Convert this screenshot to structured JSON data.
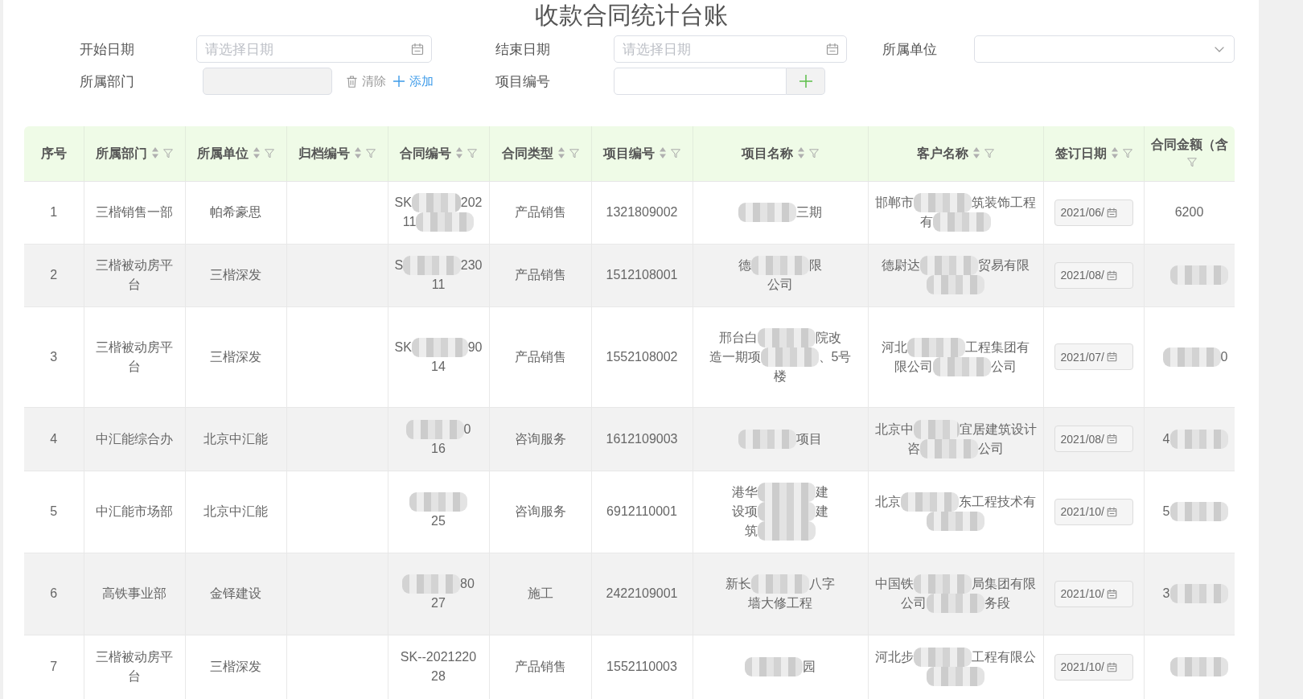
{
  "title": "收款合同统计台账",
  "filters": [
    {
      "kind": "date",
      "label": "开始日期",
      "placeholder": "请选择日期"
    },
    {
      "kind": "date",
      "label": "结束日期",
      "placeholder": "请选择日期"
    },
    {
      "kind": "select",
      "label": "所属单位"
    },
    {
      "kind": "picker",
      "label": "所属部门",
      "disabled": true,
      "actions": [
        {
          "kind": "clear",
          "label": "清除"
        },
        {
          "kind": "add",
          "label": "添加"
        }
      ]
    },
    {
      "kind": "input_add",
      "label": "项目编号"
    }
  ],
  "table": {
    "columns": [
      {
        "label": "序号",
        "sortable": false,
        "filterable": false
      },
      {
        "label": "所属部门",
        "sortable": true,
        "filterable": true
      },
      {
        "label": "所属单位",
        "sortable": true,
        "filterable": true
      },
      {
        "label": "归档编号",
        "sortable": true,
        "filterable": true
      },
      {
        "label": "合同编号",
        "sortable": true,
        "filterable": true
      },
      {
        "label": "合同类型",
        "sortable": true,
        "filterable": true
      },
      {
        "label": "项目编号",
        "sortable": true,
        "filterable": true
      },
      {
        "label": "项目名称",
        "sortable": true,
        "filterable": true
      },
      {
        "label": "客户名称",
        "sortable": true,
        "filterable": true
      },
      {
        "label": "签订日期",
        "sortable": true,
        "filterable": true
      },
      {
        "label": "合同金额（含",
        "sortable": false,
        "filterable": true
      }
    ],
    "rows": [
      {
        "index": "1",
        "department": "三楷销售一部",
        "unit": "帕希豪思",
        "contract_no": {
          "lines": [
            [
              {
                "kind": "text",
                "text": "SK"
              },
              {
                "kind": "mask"
              },
              {
                "kind": "text",
                "text": "202"
              }
            ],
            [
              {
                "kind": "text",
                "text": "11"
              },
              {
                "kind": "mask"
              }
            ]
          ]
        },
        "contract_type": "产品销售",
        "project_no": "1321809002",
        "project_name": {
          "lines": [
            [
              {
                "kind": "mask"
              },
              {
                "kind": "text",
                "text": "三期"
              }
            ]
          ]
        },
        "customer": {
          "lines": [
            [
              {
                "kind": "text",
                "text": "邯郸市"
              },
              {
                "kind": "mask"
              },
              {
                "kind": "text",
                "text": "筑装饰工程"
              }
            ],
            [
              {
                "kind": "text",
                "text": "有"
              },
              {
                "kind": "mask"
              }
            ]
          ]
        },
        "signed_date": "2021/06/",
        "amount": "6200"
      },
      {
        "index": "2",
        "department": "三楷被动房平台",
        "unit": "三楷深发",
        "contract_no": {
          "lines": [
            [
              {
                "kind": "text",
                "text": "S"
              },
              {
                "kind": "mask"
              },
              {
                "kind": "text",
                "text": "230"
              }
            ],
            [
              {
                "kind": "text",
                "text": "11"
              }
            ]
          ]
        },
        "contract_type": "产品销售",
        "project_no": "1512108001",
        "project_name": {
          "lines": [
            [
              {
                "kind": "text",
                "text": "德"
              },
              {
                "kind": "mask"
              },
              {
                "kind": "text",
                "text": "限"
              }
            ],
            [
              {
                "kind": "text",
                "text": "公司"
              }
            ]
          ]
        },
        "customer": {
          "lines": [
            [
              {
                "kind": "text",
                "text": "德尉达"
              },
              {
                "kind": "mask"
              },
              {
                "kind": "text",
                "text": "贸易有限"
              }
            ],
            [
              {
                "kind": "mask"
              }
            ]
          ]
        },
        "signed_date": "2021/08/",
        "amount": {
          "lines": [
            [
              {
                "kind": "mask"
              }
            ]
          ]
        }
      },
      {
        "index": "3",
        "department": "三楷被动房平台",
        "unit": "三楷深发",
        "contract_no": {
          "lines": [
            [
              {
                "kind": "text",
                "text": "SK"
              },
              {
                "kind": "mask"
              },
              {
                "kind": "text",
                "text": "90"
              }
            ],
            [
              {
                "kind": "text",
                "text": "14"
              }
            ]
          ]
        },
        "contract_type": "产品销售",
        "project_no": "1552108002",
        "project_name": {
          "lines": [
            [
              {
                "kind": "text",
                "text": "邢台白"
              },
              {
                "kind": "mask"
              },
              {
                "kind": "text",
                "text": "院改"
              }
            ],
            [
              {
                "kind": "text",
                "text": "造一期项"
              },
              {
                "kind": "mask"
              },
              {
                "kind": "text",
                "text": "、5号"
              }
            ],
            [
              {
                "kind": "text",
                "text": "楼"
              }
            ]
          ]
        },
        "customer": {
          "lines": [
            [
              {
                "kind": "text",
                "text": "河北"
              },
              {
                "kind": "mask"
              },
              {
                "kind": "text",
                "text": "工程集团有"
              }
            ],
            [
              {
                "kind": "text",
                "text": "限公司"
              },
              {
                "kind": "mask"
              },
              {
                "kind": "text",
                "text": "公司"
              }
            ]
          ]
        },
        "signed_date": "2021/07/",
        "amount": {
          "lines": [
            [
              {
                "kind": "mask"
              },
              {
                "kind": "text",
                "text": "0"
              }
            ]
          ]
        }
      },
      {
        "index": "4",
        "department": "中汇能综合办",
        "unit": "北京中汇能",
        "contract_no": {
          "lines": [
            [
              {
                "kind": "mask"
              },
              {
                "kind": "text",
                "text": "0"
              }
            ],
            [
              {
                "kind": "text",
                "text": "16"
              }
            ]
          ]
        },
        "contract_type": "咨询服务",
        "project_no": "1612109003",
        "project_name": {
          "lines": [
            [
              {
                "kind": "mask"
              },
              {
                "kind": "text",
                "text": "项目"
              }
            ]
          ]
        },
        "customer": {
          "lines": [
            [
              {
                "kind": "text",
                "text": "北京中"
              },
              {
                "kind": "mask"
              },
              {
                "kind": "text",
                "text": "宜居建筑设计"
              }
            ],
            [
              {
                "kind": "text",
                "text": "咨"
              },
              {
                "kind": "mask"
              },
              {
                "kind": "text",
                "text": "公司"
              }
            ]
          ]
        },
        "signed_date": "2021/08/",
        "amount": {
          "lines": [
            [
              {
                "kind": "text",
                "text": "4"
              },
              {
                "kind": "mask"
              }
            ]
          ]
        }
      },
      {
        "index": "5",
        "department": "中汇能市场部",
        "unit": "北京中汇能",
        "contract_no": {
          "lines": [
            [
              {
                "kind": "mask"
              }
            ],
            [
              {
                "kind": "text",
                "text": "25"
              }
            ]
          ]
        },
        "contract_type": "咨询服务",
        "project_no": "6912110001",
        "project_name": {
          "lines": [
            [
              {
                "kind": "text",
                "text": "港华"
              },
              {
                "kind": "mask"
              },
              {
                "kind": "text",
                "text": "建"
              }
            ],
            [
              {
                "kind": "text",
                "text": "设项"
              },
              {
                "kind": "mask"
              },
              {
                "kind": "text",
                "text": "建"
              }
            ],
            [
              {
                "kind": "text",
                "text": "筑"
              },
              {
                "kind": "mask"
              }
            ]
          ]
        },
        "customer": {
          "lines": [
            [
              {
                "kind": "text",
                "text": "北京"
              },
              {
                "kind": "mask"
              },
              {
                "kind": "text",
                "text": "东工程技术有"
              }
            ],
            [
              {
                "kind": "mask"
              }
            ]
          ]
        },
        "signed_date": "2021/10/",
        "amount": {
          "lines": [
            [
              {
                "kind": "text",
                "text": "5"
              },
              {
                "kind": "mask"
              }
            ]
          ]
        }
      },
      {
        "index": "6",
        "department": "高铁事业部",
        "unit": "金铎建设",
        "contract_no": {
          "lines": [
            [
              {
                "kind": "mask"
              },
              {
                "kind": "text",
                "text": "80"
              }
            ],
            [
              {
                "kind": "text",
                "text": "27"
              }
            ]
          ]
        },
        "contract_type": "施工",
        "project_no": "2422109001",
        "project_name": {
          "lines": [
            [
              {
                "kind": "text",
                "text": "新长"
              },
              {
                "kind": "mask"
              },
              {
                "kind": "text",
                "text": "八字"
              }
            ],
            [
              {
                "kind": "text",
                "text": "墙大修工程"
              }
            ]
          ]
        },
        "customer": {
          "lines": [
            [
              {
                "kind": "text",
                "text": "中国铁"
              },
              {
                "kind": "mask"
              },
              {
                "kind": "text",
                "text": "局集团有限"
              }
            ],
            [
              {
                "kind": "text",
                "text": "公司"
              },
              {
                "kind": "mask"
              },
              {
                "kind": "text",
                "text": "务段"
              }
            ]
          ]
        },
        "signed_date": "2021/10/",
        "amount": {
          "lines": [
            [
              {
                "kind": "text",
                "text": "3"
              },
              {
                "kind": "mask"
              }
            ]
          ]
        }
      },
      {
        "index": "7",
        "department": "三楷被动房平台",
        "unit": "三楷深发",
        "contract_no": {
          "lines": [
            [
              {
                "kind": "text",
                "text": "SK--2021220"
              }
            ],
            [
              {
                "kind": "text",
                "text": "28"
              }
            ]
          ]
        },
        "contract_type": "产品销售",
        "project_no": "1552110003",
        "project_name": {
          "lines": [
            [
              {
                "kind": "mask"
              },
              {
                "kind": "text",
                "text": "园"
              }
            ]
          ]
        },
        "customer": {
          "lines": [
            [
              {
                "kind": "text",
                "text": "河北步"
              },
              {
                "kind": "mask"
              },
              {
                "kind": "text",
                "text": "工程有限公"
              }
            ],
            [
              {
                "kind": "mask"
              }
            ]
          ]
        },
        "signed_date": "2021/10/",
        "amount": {
          "lines": [
            [
              {
                "kind": "mask"
              }
            ]
          ]
        }
      }
    ]
  }
}
